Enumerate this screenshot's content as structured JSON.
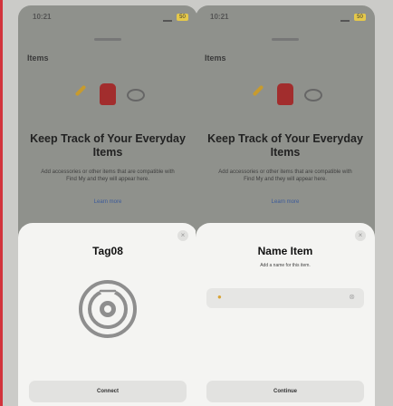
{
  "left_phone": {
    "time": "10:21",
    "battery": "50",
    "nav_title": "Items",
    "headline": "Keep Track of Your Everyday Items",
    "description": "Add accessories or other items that are compatible with Find My and they will appear here.",
    "learn_more": "Learn more",
    "sheet": {
      "title": "Tag08",
      "close": "×",
      "button_label": "Connect"
    }
  },
  "right_phone": {
    "time": "10:21",
    "battery": "50",
    "nav_title": "Items",
    "headline": "Keep Track of Your Everyday Items",
    "description": "Add accessories or other items that are compatible with Find My and they will appear here.",
    "learn_more": "Learn more",
    "sheet": {
      "title": "Name Item",
      "subtitle": "Add a name for this item.",
      "field_emoji": "●",
      "field_clear": "⊗",
      "close": "×",
      "button_label": "Continue"
    }
  },
  "colors": {
    "outer_bg": "#cbcbc8",
    "dim_bg": "#8f918c",
    "sheet_bg": "#f4f4f2",
    "accent_red": "#d2333c"
  }
}
